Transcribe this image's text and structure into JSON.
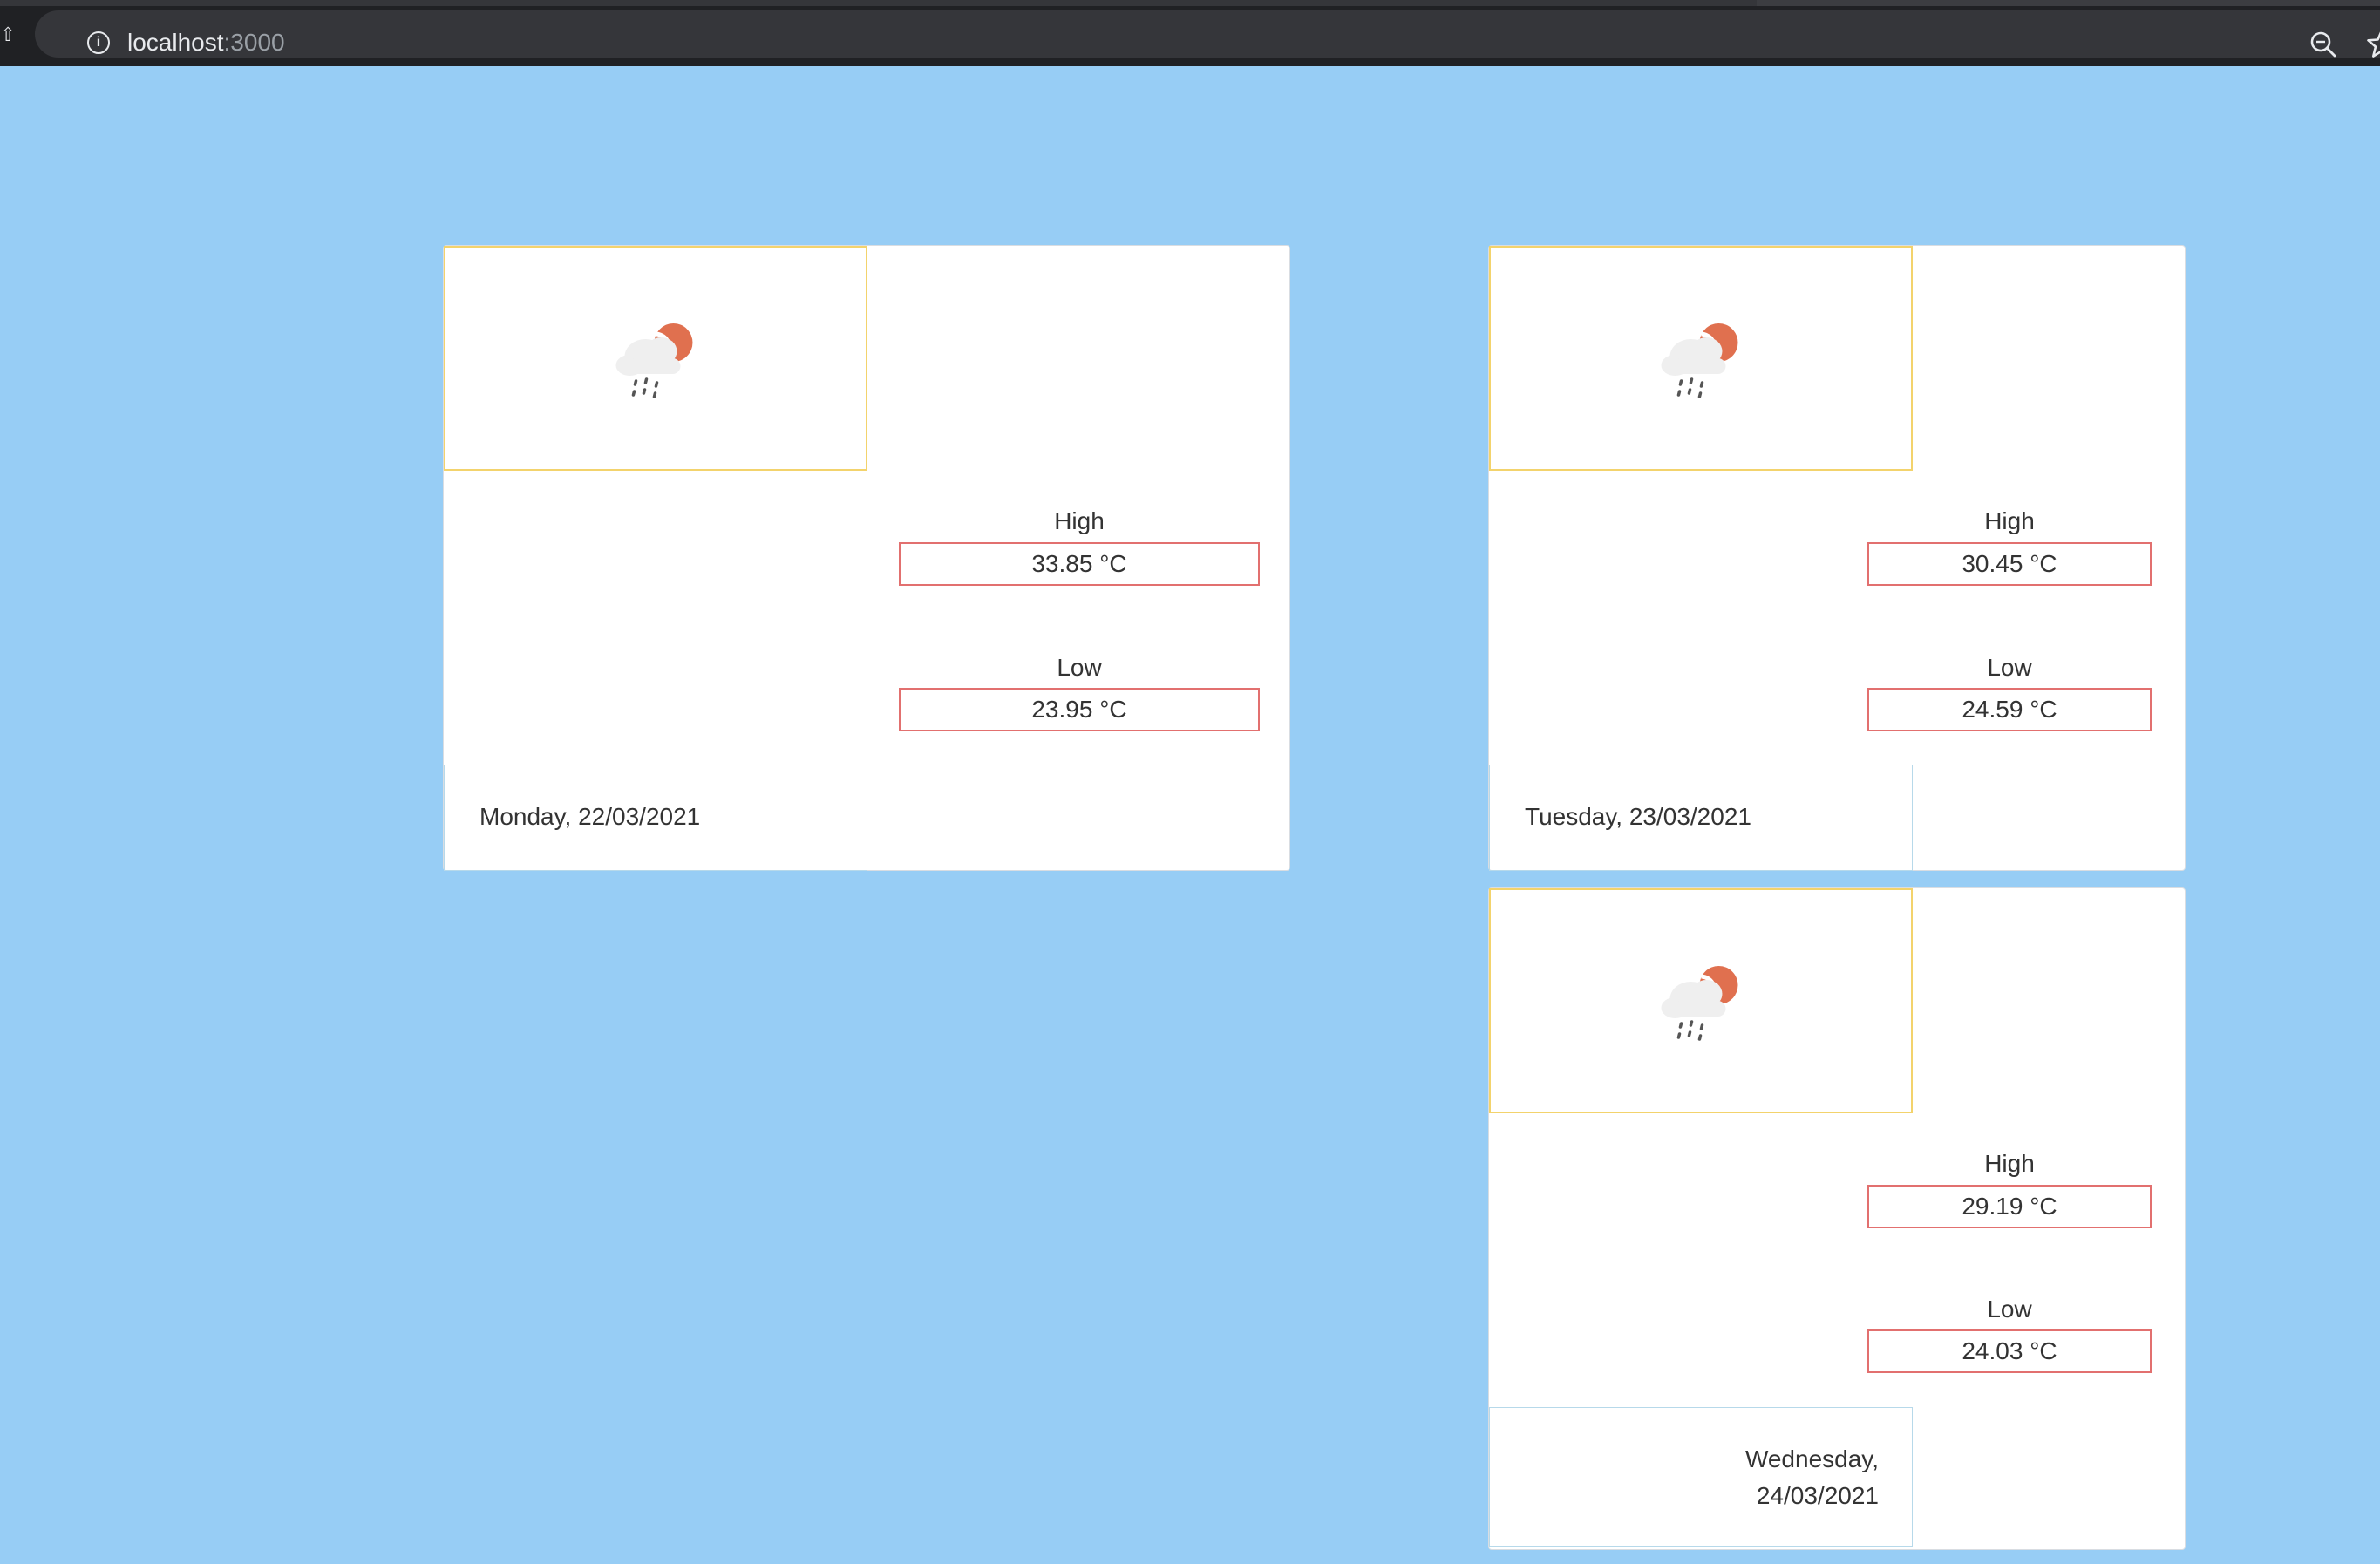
{
  "browser": {
    "url_host": "localhost",
    "url_port": ":3000"
  },
  "forecast": [
    {
      "date": "Monday, 22/03/2021",
      "high_label": "High",
      "high_value": "33.85 °C",
      "low_label": "Low",
      "low_value": "23.95 °C",
      "icon": "rain-cloud-sun-icon"
    },
    {
      "date": "Tuesday, 23/03/2021",
      "high_label": "High",
      "high_value": "30.45 °C",
      "low_label": "Low",
      "low_value": "24.59 °C",
      "icon": "rain-cloud-sun-icon"
    },
    {
      "date": "Wednesday, 24/03/2021",
      "date_line1": "Wednesday,",
      "date_line2": "24/03/2021",
      "high_label": "High",
      "high_value": "29.19 °C",
      "low_label": "Low",
      "low_value": "24.03 °C",
      "icon": "rain-cloud-sun-icon"
    }
  ],
  "colors": {
    "background": "#97cdf5",
    "icon_border": "#f3d36c",
    "temp_border": "#e2706f",
    "date_border": "#b7d9ea",
    "sun": "#e0704f"
  }
}
